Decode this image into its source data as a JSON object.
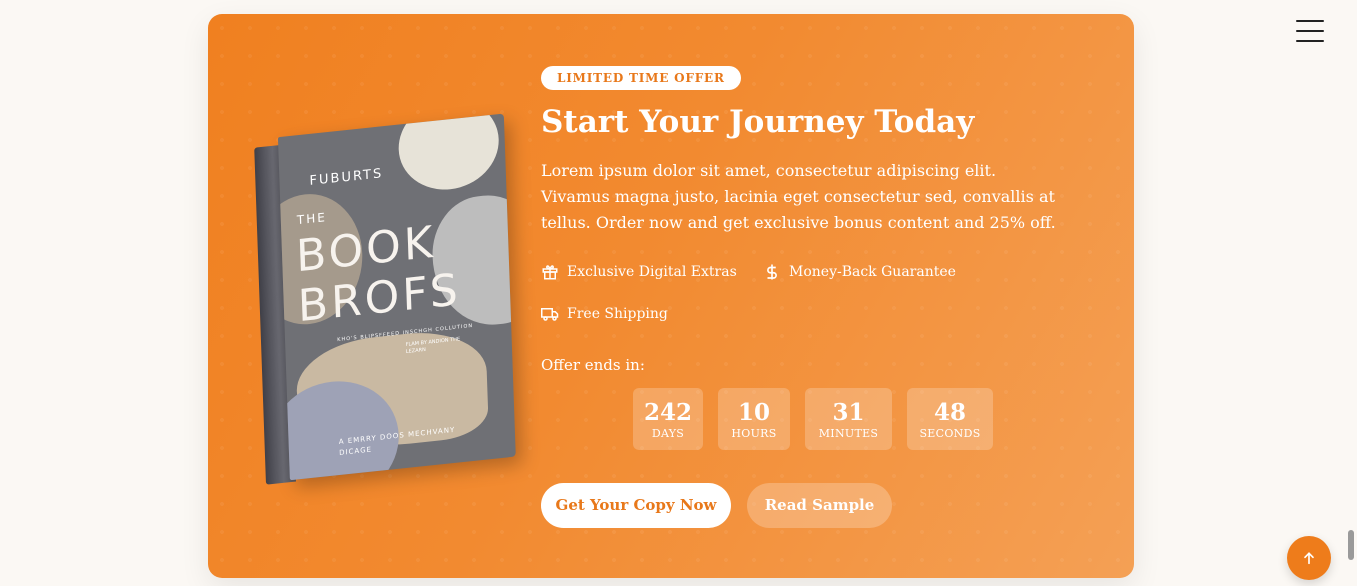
{
  "hero": {
    "badge": "LIMITED TIME OFFER",
    "title": "Start Your Journey Today",
    "description": "Lorem ipsum dolor sit amet, consectetur adipiscing elit. Vivamus magna justo, lacinia eget consectetur sed, convallis at tellus. Order now and get exclusive bonus content and 25% off.",
    "features": [
      {
        "icon": "gift-icon",
        "label": "Exclusive Digital Extras"
      },
      {
        "icon": "dollar-icon",
        "label": "Money-Back Guarantee"
      },
      {
        "icon": "truck-icon",
        "label": "Free Shipping"
      }
    ],
    "offer_label": "Offer ends in:",
    "countdown": [
      {
        "value": "242",
        "unit": "DAYS"
      },
      {
        "value": "10",
        "unit": "HOURS"
      },
      {
        "value": "31",
        "unit": "MINUTES"
      },
      {
        "value": "48",
        "unit": "SECONDS"
      }
    ],
    "primary_button": "Get Your Copy Now",
    "secondary_button": "Read Sample"
  },
  "book": {
    "author": "FUBURTS",
    "the": "THE",
    "title_line1": "BOOK",
    "title_line2": "BROFS",
    "subtitle": "KHO'S BLIPSFFEED INSCHGH COLLUTION",
    "credit": "FLAM BY ANDION THE LEZARN",
    "footer": "A EMRRY DOOS MECHVANY DICAGE"
  },
  "colors": {
    "accent": "#f08020",
    "accent_light": "#f4a055",
    "background": "#fbf8f4"
  }
}
